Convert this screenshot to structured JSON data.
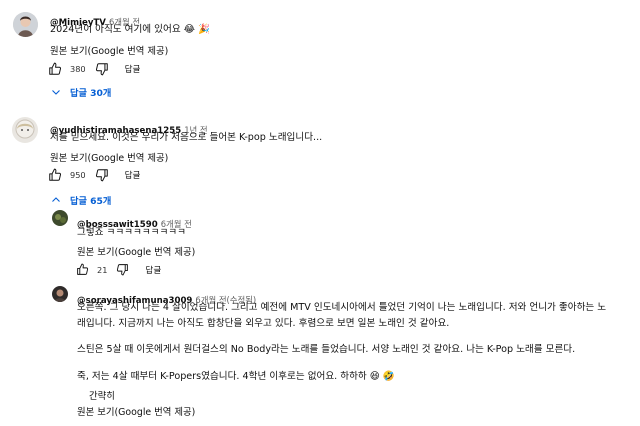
{
  "comments": [
    {
      "handle": "@MimieyTV",
      "time": "6개월 전",
      "lines": [
        "2024년이 아직도 여기에 있어요 😂 🎉"
      ],
      "translate": "원본 보기(Google 번역 제공)",
      "likes": "380",
      "reply_label": "답글",
      "replies_toggle": "답글 30개"
    },
    {
      "handle": "@yudhistiramahasena1255",
      "time": "1년 전",
      "lines": [
        "저를 믿으세요. 이것은 우리가 처음으로 들어본 K-pop 노래입니다..."
      ],
      "translate": "원본 보기(Google 번역 제공)",
      "likes": "950",
      "reply_label": "답글",
      "replies_toggle": "답글 65개"
    }
  ],
  "replies": [
    {
      "handle": "@bosssawit1590",
      "time": "6개월 전",
      "lines": [
        "그렇죠 ㅋㅋㅋㅋㅋㅋㅋㅋㅋ"
      ],
      "translate": "원본 보기(Google 번역 제공)",
      "likes": "21",
      "reply_label": "답글"
    },
    {
      "handle": "@sorayashifamuna3009",
      "time": "6개월 전(수정됨)",
      "lines": [
        "오른쪽. 그 당시 나는 4 살이었습니다. 그리고 예전에 MTV 인도네시아에서 틀었던 기억이 나는 노래입니다. 저와 언니가 좋아하는 노",
        "래입니다. 지금까지 나는 아직도 합창단을 외우고 있다. 후렴으로 보면 일본 노래인 것 같아요.",
        "",
        "스틴은 5살 때 이웃에게서 원더걸스의 No Body라는 노래를 들었습니다. 서양 노래인 것 같아요. 나는 K-Pop 노래를 모른다.",
        "",
        "죽, 저는 4살 때부터 K-Popers였습니다. 4학년 이후로는 없어요. 하하하 😆 🤣"
      ],
      "collapse": "간략히",
      "translate": "원본 보기(Google 번역 제공)"
    }
  ]
}
